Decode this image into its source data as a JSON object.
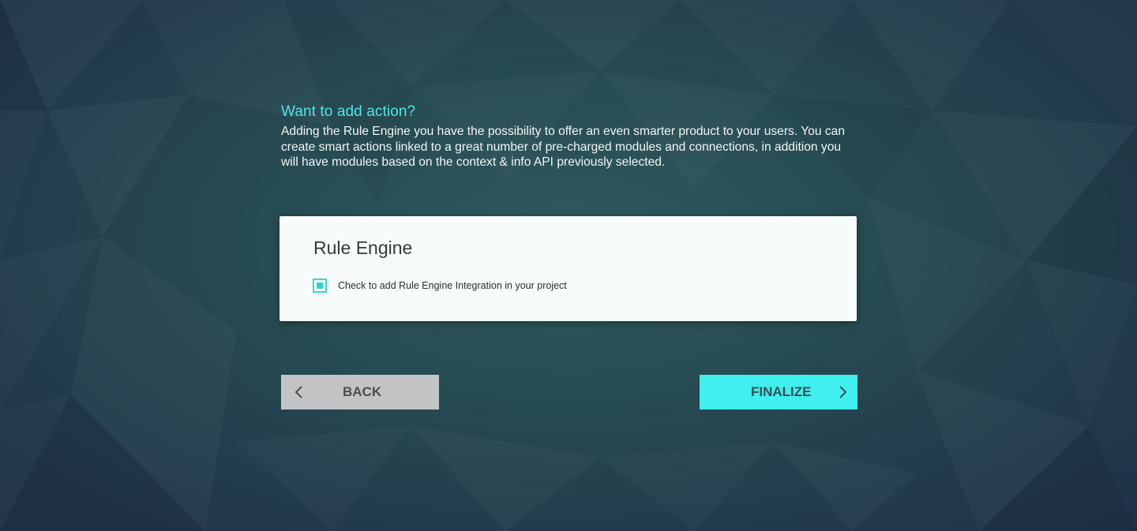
{
  "intro": {
    "title": "Want to add action?",
    "description": "Adding the Rule Engine you have the possibility to offer an even smarter product to your users. You can create smart actions linked to a great number of pre-charged modules and connections, in addition you will have modules based on the context & info API previously selected."
  },
  "card": {
    "title": "Rule Engine",
    "checkbox_label": "Check to add Rule Engine Integration in your project",
    "checked": true
  },
  "buttons": {
    "back_label": "BACK",
    "back_icon": "chevron-left-icon",
    "finalize_label": "FINALIZE",
    "finalize_icon": "chevron-right-icon"
  },
  "colors": {
    "accent": "#3ff0ee",
    "heading": "#4fe6e3",
    "back_button": "#c2c3c4",
    "background": "#274b52"
  }
}
